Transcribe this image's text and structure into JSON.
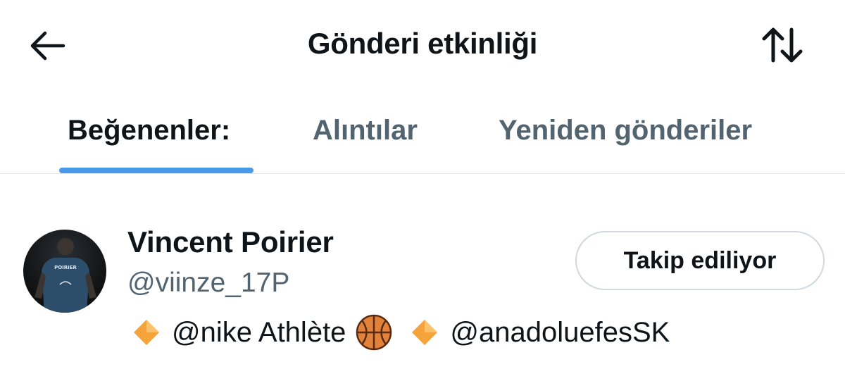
{
  "header": {
    "title": "Gönderi etkinliği",
    "back_icon": "arrow-left-icon",
    "sort_icon": "sort-arrows-icon"
  },
  "tabs": [
    {
      "label": "Beğenenler:",
      "active": true
    },
    {
      "label": "Alıntılar",
      "active": false
    },
    {
      "label": "Yeniden gönderiler",
      "active": false
    }
  ],
  "users": [
    {
      "name": "Vincent Poirier",
      "handle": "@viinze_17P",
      "follow_label": "Takip ediliyor",
      "avatar_jersey_text": "POIRIER",
      "bio": {
        "diamond_icon": "orange-diamond-icon",
        "part1": "@nike Athlète",
        "ball_icon": "basketball-icon",
        "part2": "@anadoluefesSK"
      }
    }
  ],
  "colors": {
    "accent": "#4a99e9",
    "text_primary": "#0f1419",
    "text_secondary": "#536471",
    "border": "#cfd9de",
    "diamond": "#f5a33b",
    "basketball": "#e0823a"
  }
}
